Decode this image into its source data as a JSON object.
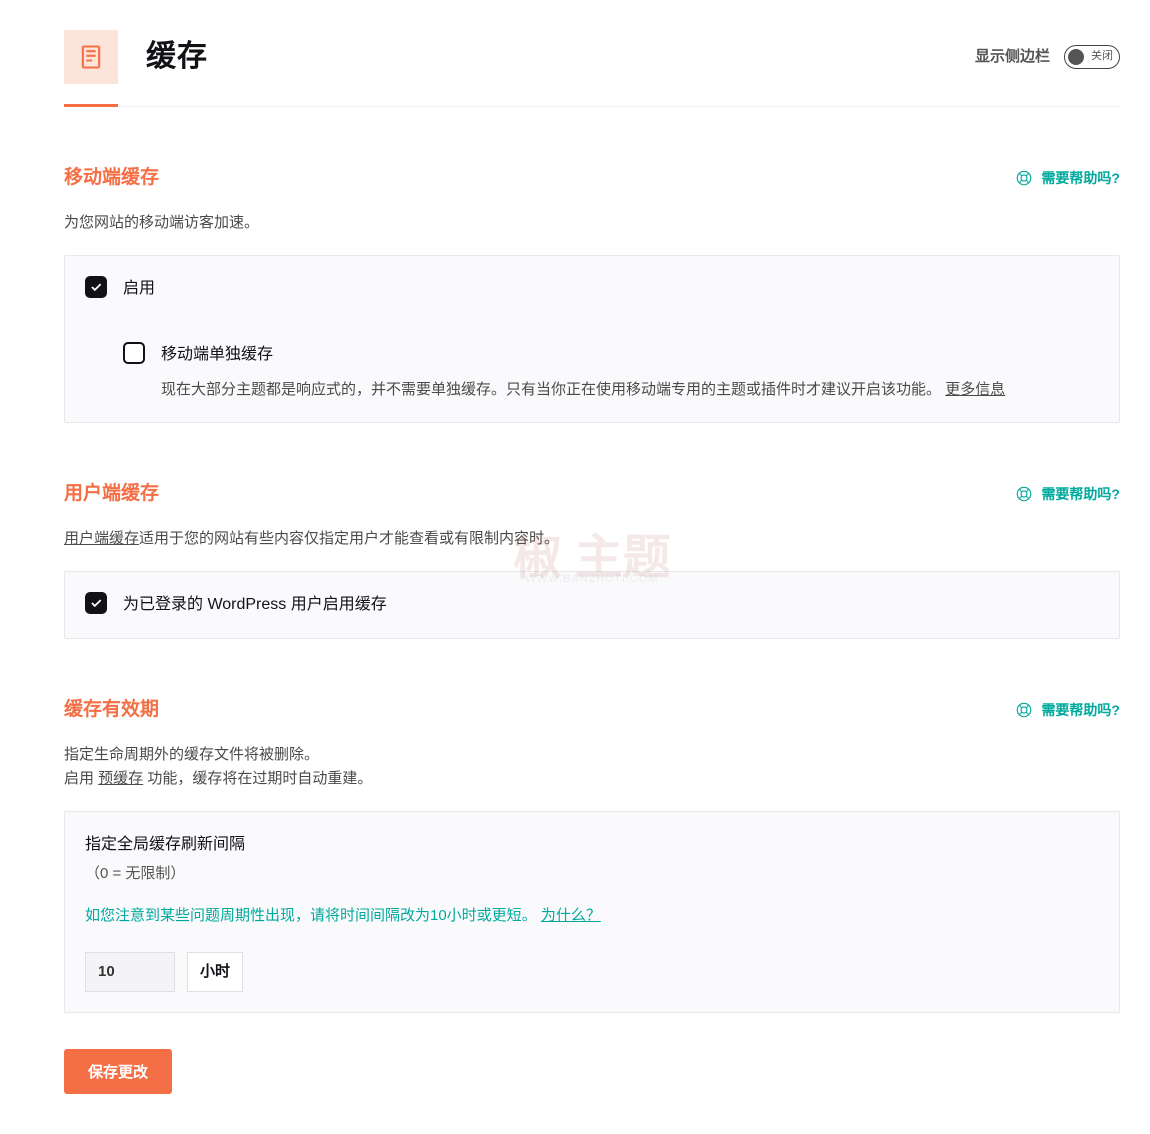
{
  "header": {
    "title": "缓存",
    "sidebar_label": "显示侧边栏",
    "toggle_state": "关闭"
  },
  "help_label": "需要帮助吗?",
  "sections": {
    "mobile": {
      "title": "移动端缓存",
      "desc": "为您网站的移动端访客加速。",
      "enable_label": "启用",
      "separate_label": "移动端单独缓存",
      "separate_help": "现在大部分主题都是响应式的，并不需要单独缓存。只有当你正在使用移动端专用的主题或插件时才建议开启该功能。",
      "more_info": "更多信息"
    },
    "user": {
      "title": "用户端缓存",
      "desc_link": "用户端缓存",
      "desc_rest": "适用于您的网站有些内容仅指定用户才能查看或有限制内容时。",
      "enable_label": "为已登录的 WordPress 用户启用缓存"
    },
    "lifespan": {
      "title": "缓存有效期",
      "desc_line1": "指定生命周期外的缓存文件将被删除。",
      "desc_line2_pre": "启用 ",
      "desc_line2_link": "预缓存",
      "desc_line2_post": " 功能，缓存将在过期时自动重建。",
      "field_label": "指定全局缓存刷新间隔",
      "field_sub": "（0 = 无限制）",
      "warn_text": "如您注意到某些问题周期性出现，请将时间间隔改为10小时或更短。",
      "why": "为什么？",
      "value": "10",
      "unit": "小时"
    }
  },
  "save_button": "保存更改",
  "watermark": {
    "main": "椒 主题",
    "url": "WWW.BANZHUTI.COM"
  }
}
